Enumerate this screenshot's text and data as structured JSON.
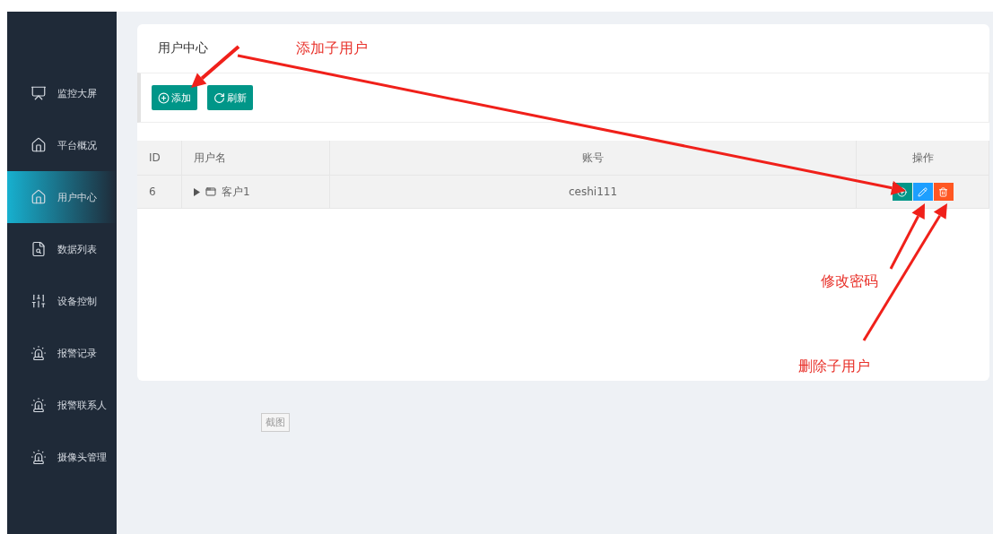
{
  "sidebar": {
    "items": [
      {
        "label": "监控大屏",
        "selected": false
      },
      {
        "label": "平台概况",
        "selected": false
      },
      {
        "label": "用户中心",
        "selected": true
      },
      {
        "label": "数据列表",
        "selected": false
      },
      {
        "label": "设备控制",
        "selected": false
      },
      {
        "label": "报警记录",
        "selected": false
      },
      {
        "label": "报警联系人",
        "selected": false
      },
      {
        "label": "摄像头管理",
        "selected": false
      }
    ]
  },
  "panel": {
    "title": "用户中心",
    "toolbar": [
      {
        "label": "添加",
        "kind": "add"
      },
      {
        "label": "刷新",
        "kind": "refresh"
      }
    ]
  },
  "table": {
    "columns": [
      "ID",
      "用户名",
      "账号",
      "操作"
    ],
    "rows": [
      {
        "id": "6",
        "name": "客户1",
        "expanded": false,
        "account": "ceshi111",
        "actions": [
          {
            "kind": "add"
          },
          {
            "kind": "edit"
          },
          {
            "kind": "delete"
          }
        ]
      }
    ]
  },
  "screenshot_button": "截图",
  "annotations": [
    {
      "label": "添加子用户"
    },
    {
      "label": "修改密码"
    },
    {
      "label": "删除子用户"
    }
  ]
}
